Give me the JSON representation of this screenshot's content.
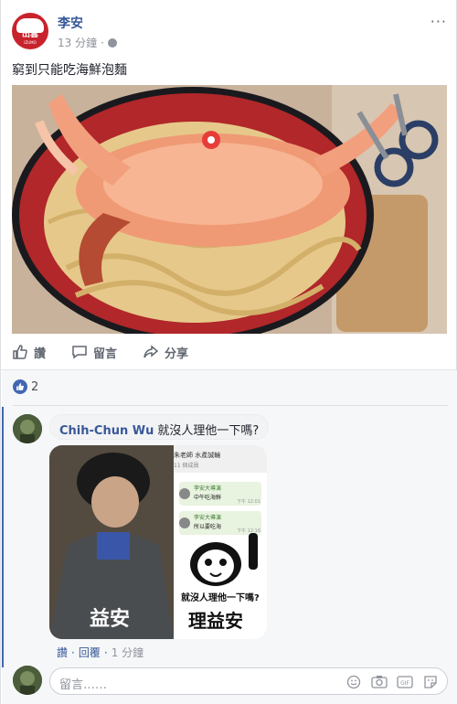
{
  "post": {
    "author": "李安",
    "timestamp": "13 分鐘",
    "meta_separator": "·",
    "text": "窮到只能吃海鮮泡麵",
    "avatar_text": "出雲",
    "avatar_subtext": "IZUMO",
    "more_label": "···"
  },
  "actions": {
    "like_label": "讚",
    "comment_label": "留言",
    "share_label": "分享"
  },
  "reactions": {
    "like_count": "2"
  },
  "comment": {
    "author": "Chih-Chun Wu",
    "text": "就沒人理他一下嗎?",
    "like_link": "讚",
    "reply_link": "回覆",
    "separator": "·",
    "time": "1 分鐘",
    "image": {
      "left_caption": "益安",
      "chat_title": "朱老師 水產誠輪",
      "chat_members": "11 個成員",
      "chat_msg1_name": "李安大導演",
      "chat_msg1_text": "中午吃海鮮",
      "chat_msg1_time": "下午 12:01",
      "chat_msg2_name": "李安大導演",
      "chat_msg2_text": "所以要吃海",
      "chat_msg2_time": "下午 12:16",
      "meme_question": "就沒人理他一下嗎?",
      "meme_caption": "理益安"
    }
  },
  "reply": {
    "placeholder": "留言……"
  },
  "icons": {
    "like": "thumbs-up-icon",
    "comment": "speech-bubble-icon",
    "share": "share-arrow-icon",
    "emoji": "smiley-icon",
    "camera": "camera-icon",
    "gif": "gif-icon",
    "sticker": "sticker-icon"
  },
  "colors": {
    "link": "#365899",
    "accent": "#4267b2",
    "brand_red": "#c8232c"
  }
}
